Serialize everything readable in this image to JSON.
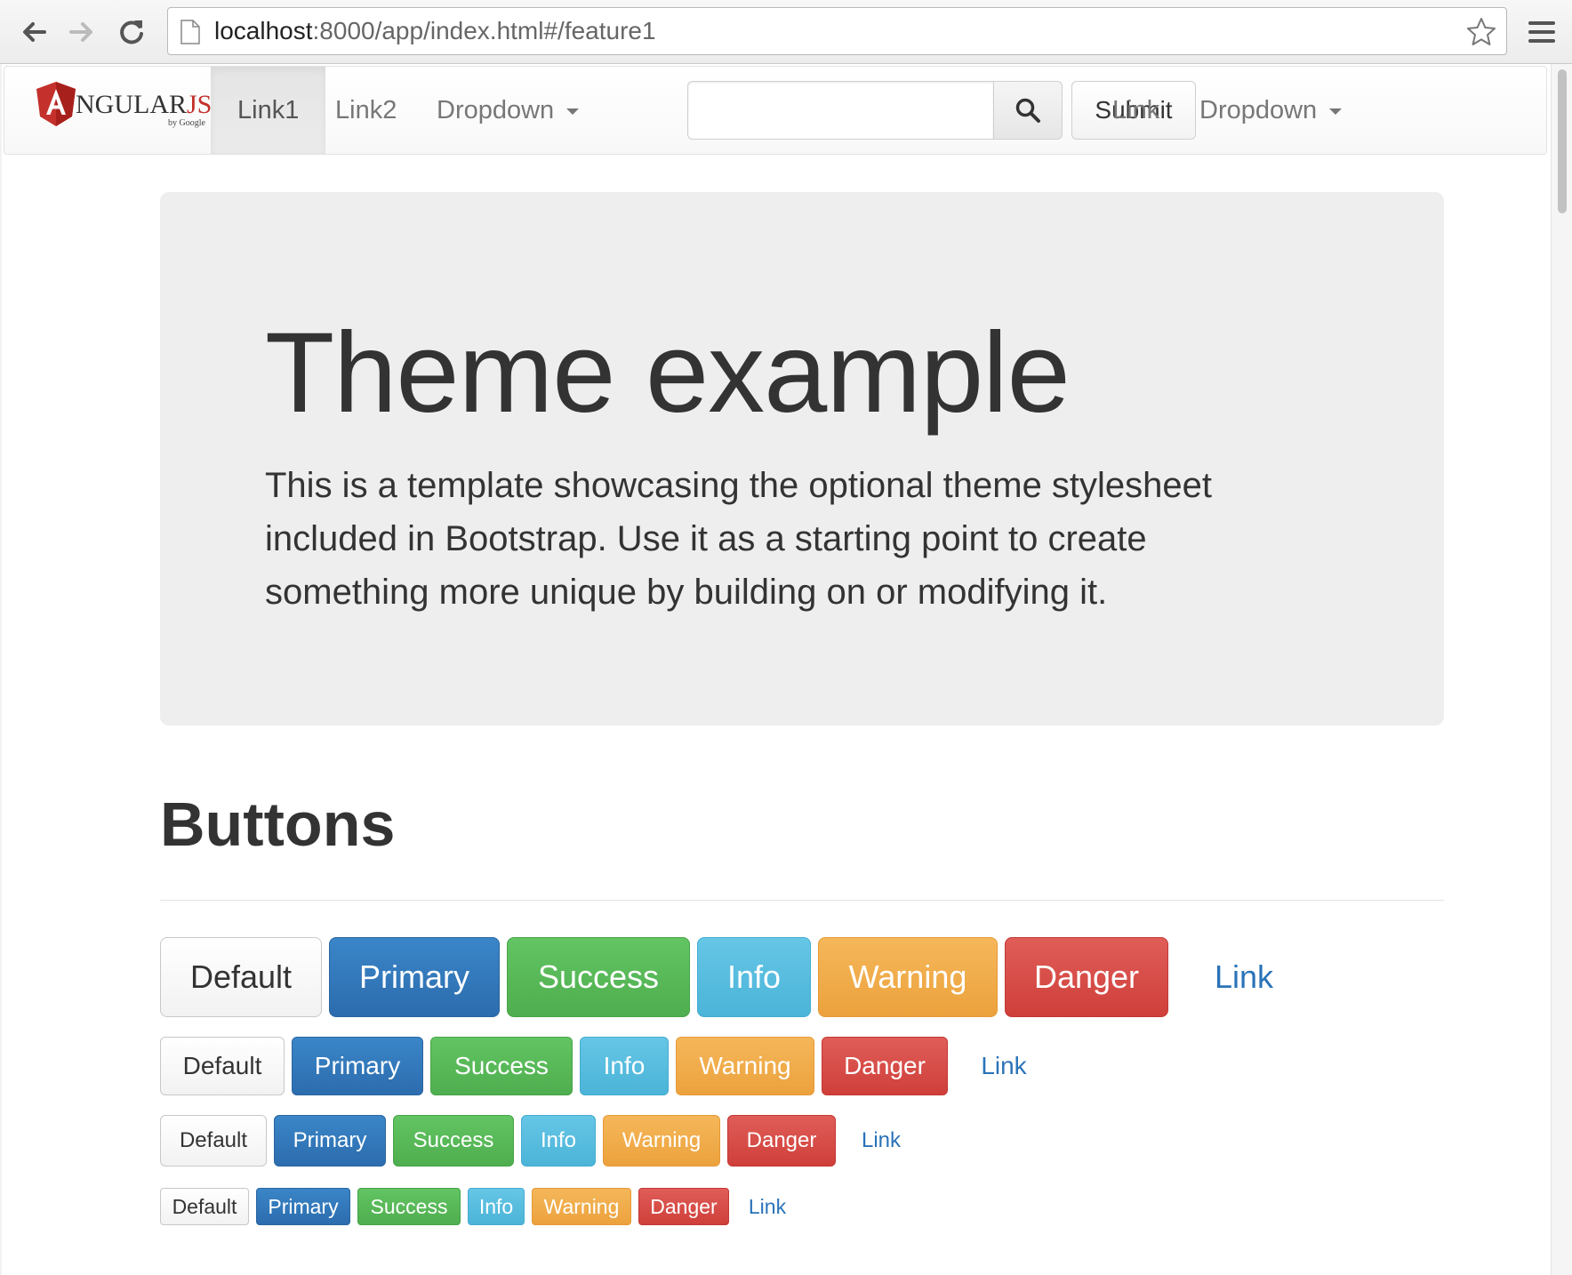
{
  "browser": {
    "url_host": "localhost",
    "url_rest": ":8000/app/index.html#/feature1"
  },
  "navbar": {
    "brand": {
      "text_main": "NGULAR",
      "text_js": "JS",
      "by_text": "by Google",
      "shield_letter": "A"
    },
    "links": [
      "Link1",
      "Link2",
      "Dropdown"
    ],
    "search": {
      "value": "",
      "placeholder": ""
    },
    "submit_label": "Submit",
    "right_links": [
      "Link",
      "Dropdown"
    ]
  },
  "jumbotron": {
    "title": "Theme example",
    "lead": "This is a template showcasing the optional theme stylesheet included in Bootstrap. Use it as a starting point to create something more unique by building on or modifying it."
  },
  "buttons_section": {
    "title": "Buttons",
    "labels": [
      "Default",
      "Primary",
      "Success",
      "Info",
      "Warning",
      "Danger",
      "Link"
    ]
  },
  "colors": {
    "primary": "#337ab7",
    "success": "#5cb85c",
    "info": "#5bc0de",
    "warning": "#f0ad4e",
    "danger": "#d9534f",
    "angular_red": "#c4302b"
  },
  "icons": {
    "back": "arrow-left-icon",
    "forward": "arrow-right-icon",
    "reload": "reload-icon",
    "page": "page-icon",
    "bookmark": "star-icon",
    "menu": "hamburger-menu-icon",
    "search": "search-icon",
    "dropdown": "caret-down-icon"
  }
}
